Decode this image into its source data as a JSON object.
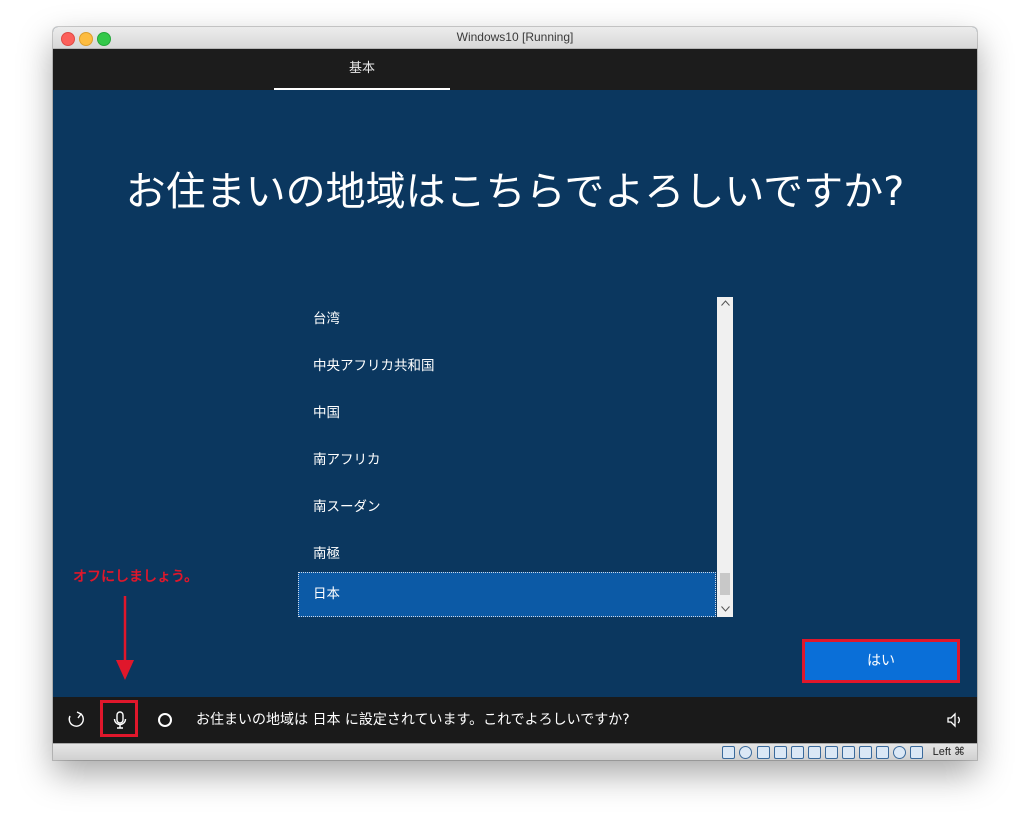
{
  "window": {
    "title": "Windows10 [Running]",
    "host_key": "Left ⌘"
  },
  "setup": {
    "tab_label": "基本",
    "headline": "お住まいの地域はこちらでよろしいですか?",
    "regions": [
      "台湾",
      "中央アフリカ共和国",
      "中国",
      "南アフリカ",
      "南スーダン",
      "南極",
      "日本"
    ],
    "selected_region": "日本",
    "yes_button": "はい"
  },
  "taskbar": {
    "status_text": "お住まいの地域は 日本 に設定されています。これでよろしいですか?"
  },
  "annotation": {
    "text": "オフにしましょう。",
    "color": "#e0172b"
  },
  "colors": {
    "background": "#0b375f",
    "selection": "#0c5aa6",
    "button": "#0a6fd8",
    "taskbar": "#1a1a1a"
  }
}
